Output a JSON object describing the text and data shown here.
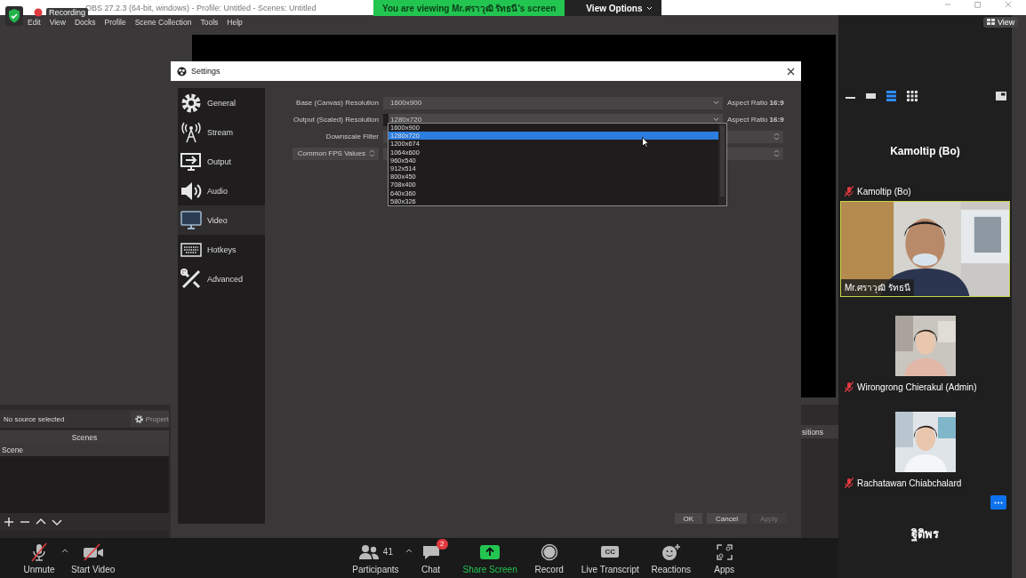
{
  "obs_title": "OBS 27.2.3 (64-bit, windows) - Profile: Untitled - Scenes: Untitled",
  "recording_label": "Recording",
  "share_banner": {
    "text": "You are viewing Mr.ศราวุฒิ รัทธนี's screen",
    "view_options": "View Options"
  },
  "view_button": "View",
  "obs_menu": [
    "Edit",
    "View",
    "Docks",
    "Profile",
    "Scene Collection",
    "Tools",
    "Help"
  ],
  "settings": {
    "title": "Settings",
    "sidebar": [
      {
        "label": "General",
        "selected": false
      },
      {
        "label": "Stream",
        "selected": false
      },
      {
        "label": "Output",
        "selected": false
      },
      {
        "label": "Audio",
        "selected": false
      },
      {
        "label": "Video",
        "selected": true
      },
      {
        "label": "Hotkeys",
        "selected": false
      },
      {
        "label": "Advanced",
        "selected": false
      }
    ],
    "rows": [
      {
        "label": "Base (Canvas) Resolution",
        "value": "1600x900",
        "aspect": "Aspect Ratio **16:9**"
      },
      {
        "label": "Output (Scaled) Resolution",
        "value": "1280x720",
        "aspect": "Aspect Ratio **16:9**"
      }
    ],
    "downscale_label": "Downscale Filter",
    "fps_label": "Common FPS Values",
    "dropdown": [
      {
        "label": "1600x900",
        "selected": false
      },
      {
        "label": "1280x720",
        "selected": true
      },
      {
        "label": "1200x674",
        "selected": false
      },
      {
        "label": "1064x600",
        "selected": false
      },
      {
        "label": "960x540",
        "selected": false
      },
      {
        "label": "912x514",
        "selected": false
      },
      {
        "label": "800x450",
        "selected": false
      },
      {
        "label": "708x400",
        "selected": false
      },
      {
        "label": "640x360",
        "selected": false
      },
      {
        "label": "580x326",
        "selected": false
      }
    ],
    "buttons": [
      {
        "label": "OK",
        "disabled": false
      },
      {
        "label": "Cancel",
        "disabled": false
      },
      {
        "label": "Apply",
        "disabled": true
      }
    ]
  },
  "obs_docks": {
    "source_status": "No source selected",
    "properties": "Propert",
    "scenes_header": "Scenes",
    "scenes": [
      {
        "label": "Scene",
        "selected": true
      }
    ],
    "transitions_header": "sitions"
  },
  "gallery": {
    "tiles": [
      {
        "kind": "name",
        "display_name": "Kamoltip (Bo)",
        "label": "Kamoltip (Bo)",
        "muted": true,
        "speaking": false
      },
      {
        "kind": "video",
        "label": "Mr.ศราวุฒิ รัทธนี",
        "muted": false,
        "speaking": true
      },
      {
        "label": "Wirongrong Chierakul (Admin)",
        "muted": true,
        "speaking": false
      },
      {
        "label": "Rachatawan Chiabchalard",
        "muted": true,
        "speaking": false,
        "more_button": true
      },
      {
        "kind": "name",
        "display_name": "ฐิติพร",
        "speaking": false
      }
    ]
  },
  "toolbar": [
    {
      "kind": "mic",
      "label": "Unmute",
      "off": true
    },
    {
      "kind": "camera",
      "label": "Start Video",
      "off": true
    },
    {
      "kind": "participants",
      "label": "Participants",
      "count": "41"
    },
    {
      "kind": "chat",
      "label": "Chat",
      "badge": "2"
    },
    {
      "kind": "share",
      "label": "Share Screen"
    },
    {
      "kind": "record",
      "label": "Record"
    },
    {
      "kind": "cc",
      "label": "Live Transcript",
      "icon_text": "CC"
    },
    {
      "kind": "reactions",
      "label": "Reactions"
    },
    {
      "kind": "apps",
      "label": "Apps"
    }
  ]
}
